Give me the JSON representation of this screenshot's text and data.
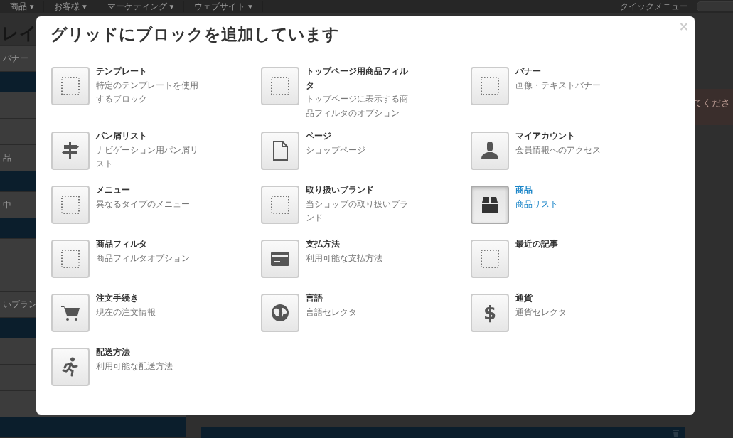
{
  "background": {
    "nav": [
      "商品 ▾",
      "お客様 ▾",
      "マーケティング ▾",
      "ウェブサイト ▾"
    ],
    "quick_menu": "クイックメニュー",
    "page_title": "レイ",
    "left_rows": [
      {
        "kind": "block",
        "text": "バナー"
      },
      {
        "kind": "bar"
      },
      {
        "kind": "block"
      },
      {
        "kind": "block"
      },
      {
        "kind": "block",
        "text": "品"
      },
      {
        "kind": "bar"
      },
      {
        "kind": "block",
        "text": "中"
      },
      {
        "kind": "bar"
      },
      {
        "kind": "block"
      },
      {
        "kind": "block"
      },
      {
        "kind": "block",
        "text": "いブラン"
      },
      {
        "kind": "bar"
      },
      {
        "kind": "block"
      },
      {
        "kind": "block"
      },
      {
        "kind": "block"
      },
      {
        "kind": "bar"
      }
    ],
    "alert": "てくださ"
  },
  "dialog": {
    "title": "グリッドにブロックを追加しています",
    "close": "×",
    "blocks": [
      {
        "title": "テンプレート",
        "description": "特定のテンプレートを使用するブロック",
        "kind": "dotted",
        "selected": false
      },
      {
        "title": "トップページ用商品フィルタ",
        "description": "トップページに表示する商品フィルタのオプション",
        "kind": "dotted",
        "selected": false
      },
      {
        "title": "バナー",
        "description": "画像・テキストバナー",
        "kind": "dotted",
        "selected": false
      },
      {
        "title": "パン屑リスト",
        "description": "ナビゲーション用パン屑リスト",
        "kind": "signpost",
        "selected": false
      },
      {
        "title": "ページ",
        "description": "ショップページ",
        "kind": "page",
        "selected": false
      },
      {
        "title": "マイアカウント",
        "description": "会員情報へのアクセス",
        "kind": "person",
        "selected": false
      },
      {
        "title": "メニュー",
        "description": "異なるタイプのメニュー",
        "kind": "dotted",
        "selected": false
      },
      {
        "title": "取り扱いブランド",
        "description": "当ショップの取り扱いブランド",
        "kind": "dotted",
        "selected": false
      },
      {
        "title": "商品",
        "description": "商品リスト",
        "kind": "box",
        "selected": true
      },
      {
        "title": "商品フィルタ",
        "description": "商品フィルタオプション",
        "kind": "dotted",
        "selected": false
      },
      {
        "title": "支払方法",
        "description": "利用可能な支払方法",
        "kind": "card",
        "selected": false
      },
      {
        "title": "最近の記事",
        "kind": "dotted",
        "selected": false
      },
      {
        "title": "注文手続き",
        "description": "現在の注文情報",
        "kind": "cart",
        "selected": false
      },
      {
        "title": "言語",
        "description": "言語セレクタ",
        "kind": "globe",
        "selected": false
      },
      {
        "title": "通貨",
        "description": "通貨セレクタ",
        "kind": "glyph",
        "glyph": "$",
        "selected": false
      },
      {
        "title": "配送方法",
        "description": "利用可能な配送方法",
        "kind": "runner",
        "selected": false
      }
    ]
  }
}
